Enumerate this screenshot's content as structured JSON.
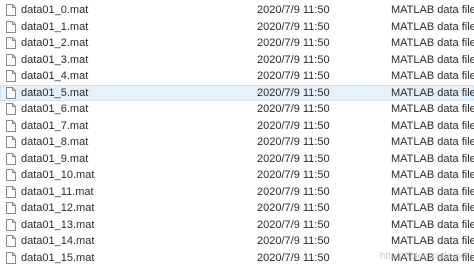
{
  "files": [
    {
      "name": "data01_0.mat",
      "modified": "2020/7/9 11:50",
      "type": "MATLAB data file",
      "selected": false,
      "icon": "blank-file-icon"
    },
    {
      "name": "data01_1.mat",
      "modified": "2020/7/9 11:50",
      "type": "MATLAB data file",
      "selected": false,
      "icon": "blank-file-icon"
    },
    {
      "name": "data01_2.mat",
      "modified": "2020/7/9 11:50",
      "type": "MATLAB data file",
      "selected": false,
      "icon": "blank-file-icon"
    },
    {
      "name": "data01_3.mat",
      "modified": "2020/7/9 11:50",
      "type": "MATLAB data file",
      "selected": false,
      "icon": "blank-file-icon"
    },
    {
      "name": "data01_4.mat",
      "modified": "2020/7/9 11:50",
      "type": "MATLAB data file",
      "selected": false,
      "icon": "blank-file-icon"
    },
    {
      "name": "data01_5.mat",
      "modified": "2020/7/9 11:50",
      "type": "MATLAB data file",
      "selected": true,
      "icon": "blank-file-icon"
    },
    {
      "name": "data01_6.mat",
      "modified": "2020/7/9 11:50",
      "type": "MATLAB data file",
      "selected": false,
      "icon": "blank-file-icon"
    },
    {
      "name": "data01_7.mat",
      "modified": "2020/7/9 11:50",
      "type": "MATLAB data file",
      "selected": false,
      "icon": "blank-file-icon"
    },
    {
      "name": "data01_8.mat",
      "modified": "2020/7/9 11:50",
      "type": "MATLAB data file",
      "selected": false,
      "icon": "blank-file-icon"
    },
    {
      "name": "data01_9.mat",
      "modified": "2020/7/9 11:50",
      "type": "MATLAB data file",
      "selected": false,
      "icon": "blank-file-icon"
    },
    {
      "name": "data01_10.mat",
      "modified": "2020/7/9 11:50",
      "type": "MATLAB data file",
      "selected": false,
      "icon": "blank-file-icon"
    },
    {
      "name": "data01_11.mat",
      "modified": "2020/7/9 11:50",
      "type": "MATLAB data file",
      "selected": false,
      "icon": "blank-file-icon"
    },
    {
      "name": "data01_12.mat",
      "modified": "2020/7/9 11:50",
      "type": "MATLAB data file",
      "selected": false,
      "icon": "blank-file-icon"
    },
    {
      "name": "data01_13.mat",
      "modified": "2020/7/9 11:50",
      "type": "MATLAB data file",
      "selected": false,
      "icon": "blank-file-icon"
    },
    {
      "name": "data01_14.mat",
      "modified": "2020/7/9 11:50",
      "type": "MATLAB data file",
      "selected": false,
      "icon": "blank-file-icon"
    },
    {
      "name": "data01_15.mat",
      "modified": "2020/7/9 11:50",
      "type": "MATLAB data file",
      "selected": false,
      "icon": "blank-file-icon"
    }
  ],
  "watermark": "https://blog.csdn.net/",
  "colors": {
    "selected_background": "#e5f1fb",
    "selected_border": "#cce4f7",
    "text": "#2b2b2b"
  }
}
